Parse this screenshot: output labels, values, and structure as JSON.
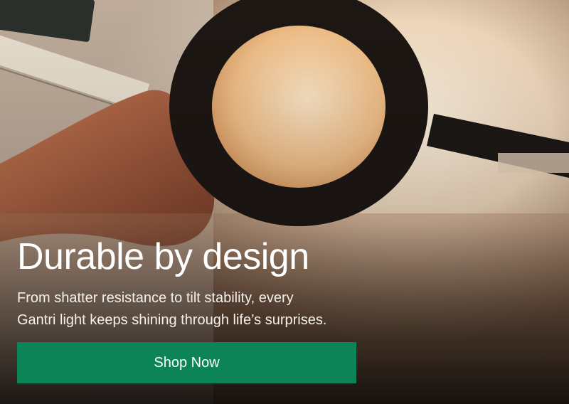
{
  "hero": {
    "title": "Durable by design",
    "subtitle_line1": "From shatter resistance to tilt stability, every",
    "subtitle_line2": "Gantri light keeps shining through life’s surprises.",
    "cta_label": "Shop Now"
  },
  "colors": {
    "button": "#0d8457",
    "text": "#ffffff"
  }
}
